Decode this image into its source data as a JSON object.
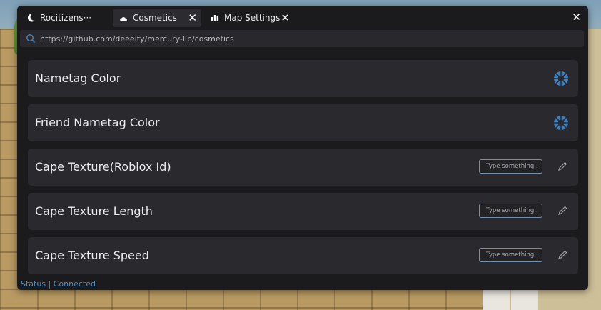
{
  "tabs": [
    {
      "label": "Rocitizens···",
      "icon": "moon-icon",
      "active": false
    },
    {
      "label": "Cosmetics",
      "icon": "hat-icon",
      "active": true
    },
    {
      "label": "Map Settings",
      "icon": "map-icon",
      "active": false
    }
  ],
  "address_bar": {
    "url": "https://github.com/deeeity/mercury-lib/cosmetics",
    "icon": "search-icon"
  },
  "rows": [
    {
      "label": "Nametag Color",
      "control": "color-picker-icon"
    },
    {
      "label": "Friend Nametag Color",
      "control": "color-picker-icon"
    },
    {
      "label": "Cape Texture(Roblox Id)",
      "placeholder": "Type something..",
      "control": "pencil-icon"
    },
    {
      "label": "Cape Texture Length",
      "placeholder": "Type something..",
      "control": "pencil-icon"
    },
    {
      "label": "Cape Texture Speed",
      "placeholder": "Type something..",
      "control": "pencil-icon"
    }
  ],
  "status": "Status | Connected",
  "colors": {
    "window": "#1b1b1e",
    "row": "#2a2a2e",
    "accent": "#3d7fbf",
    "status": "#4a8fc4"
  }
}
